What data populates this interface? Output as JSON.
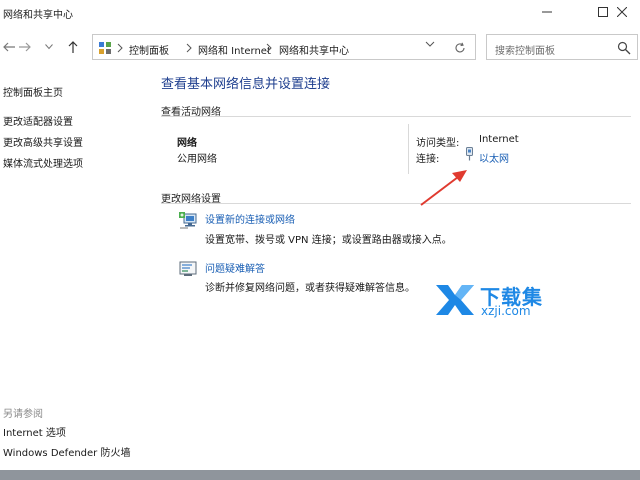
{
  "window": {
    "title": "网络和共享中心"
  },
  "address_bar": {
    "crumbs": [
      "控制面板",
      "网络和 Internet",
      "网络和共享中心"
    ]
  },
  "search": {
    "placeholder": "搜索控制面板"
  },
  "left_nav": {
    "links": [
      "控制面板主页",
      "更改适配器设置",
      "更改高级共享设置",
      "媒体流式处理选项"
    ],
    "see_also_label": "另请参阅",
    "see_also_links": [
      "Internet 选项",
      "Windows Defender 防火墙"
    ]
  },
  "main": {
    "title": "查看基本网络信息并设置连接",
    "active_networks_label": "查看活动网络",
    "network": {
      "name": "网络",
      "type": "公用网络",
      "access_type_label": "访问类型:",
      "access_type_value": "Internet",
      "connection_label": "连接:",
      "connection_value": "以太网"
    },
    "change_settings_label": "更改网络设置",
    "tasks": [
      {
        "title": "设置新的连接或网络",
        "description": "设置宽带、拨号或 VPN 连接；或设置路由器或接入点。",
        "icon": "network-setup-icon"
      },
      {
        "title": "问题疑难解答",
        "description": "诊断并修复网络问题，或者获得疑难解答信息。",
        "icon": "troubleshoot-icon"
      }
    ]
  },
  "watermark": {
    "title": "下载集",
    "subtitle": "xzji.com"
  },
  "colors": {
    "link": "#1a5fb4",
    "title": "#1f3f8f",
    "annotation_arrow": "#e03a2f",
    "watermark": "#1e88e5"
  }
}
